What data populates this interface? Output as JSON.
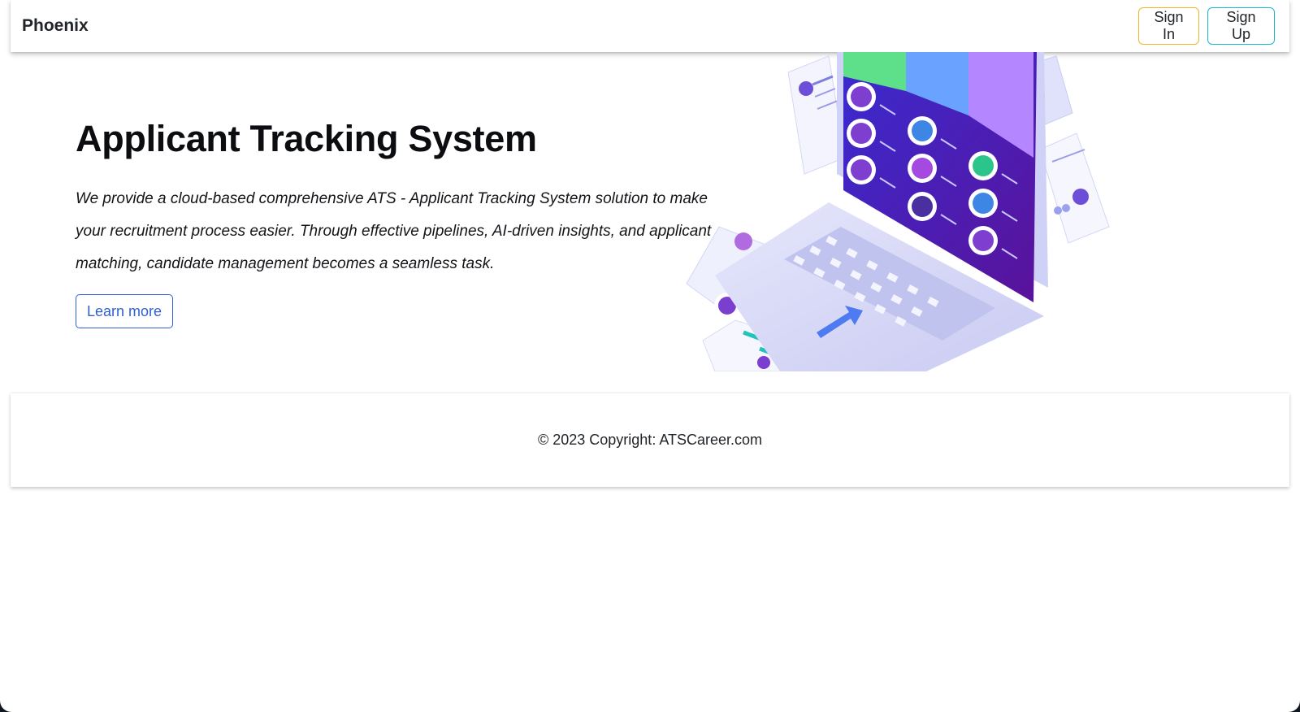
{
  "navbar": {
    "brand": "Phoenix",
    "sign_in_label": "Sign In",
    "sign_up_label": "Sign Up"
  },
  "hero": {
    "title": "Applicant Tracking System",
    "description": "We provide a cloud-based comprehensive ATS - Applicant Tracking System solution to make your recruitment process easier. Through effective pipelines, AI-driven insights, and applicant matching, candidate management becomes a seamless task.",
    "learn_more_label": "Learn more"
  },
  "footer": {
    "copyright": "© 2023 Copyright: ATSCareer.com"
  },
  "colors": {
    "sign_in_border": "#f0b429",
    "sign_up_border": "#17b9cf",
    "link_blue": "#2f5fd0",
    "screen_purple": "#4a24b8"
  },
  "icons": [
    "laptop-illustration",
    "candidate-avatar-icon",
    "resume-card-icon",
    "arrow-icon"
  ]
}
